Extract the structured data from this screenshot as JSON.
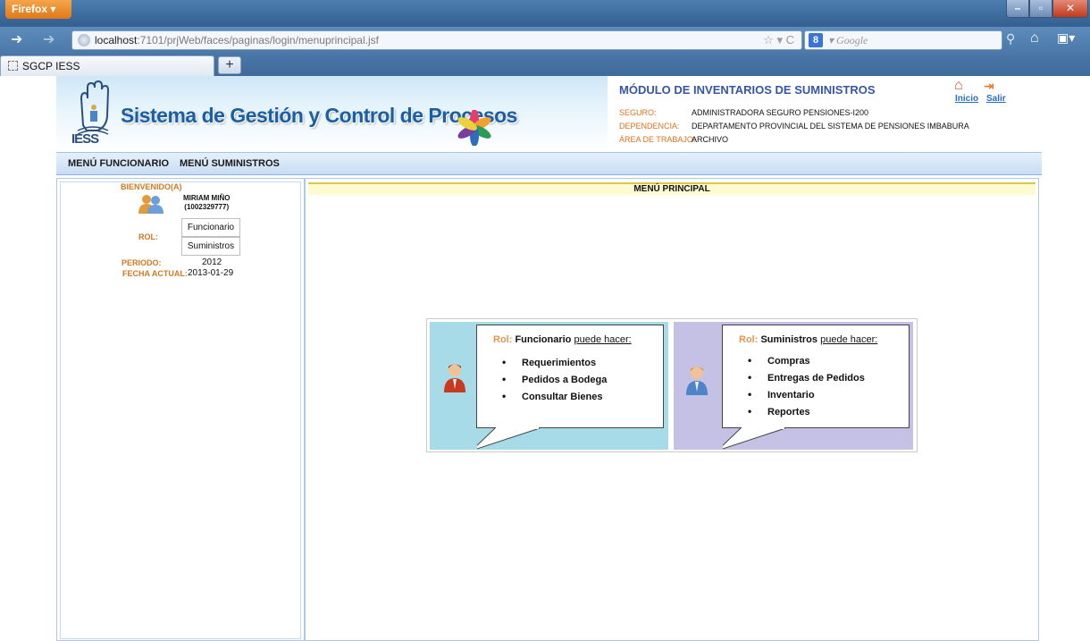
{
  "browser": {
    "firefox_label": "Firefox",
    "url_host": "localhost",
    "url_rest": ":7101/prjWeb/faces/paginas/login/menuprincipal.jsf",
    "search_placeholder": "Google",
    "tab_title": "SGCP IESS",
    "new_tab_label": "+"
  },
  "header": {
    "logo_text": "IESS",
    "app_title": "Sistema de Gestión y Control de Procesos",
    "module_title": "MÓDULO DE INVENTARIOS DE SUMINISTROS",
    "info": [
      {
        "key": "SEGURO:",
        "value": "ADMINISTRADORA SEGURO PENSIONES-I200"
      },
      {
        "key": "DEPENDENCIA:",
        "value": "DEPARTAMENTO PROVINCIAL DEL SISTEMA DE PENSIONES IMBABURA"
      },
      {
        "key": "ÁREA DE TRABAJO:",
        "value": "ARCHIVO"
      }
    ],
    "links": {
      "home": "Inicio",
      "logout": "Salir"
    }
  },
  "menubar": {
    "items": [
      "MENÚ FUNCIONARIO",
      "MENÚ SUMINISTROS"
    ]
  },
  "sidebar": {
    "welcome": "BIENVENIDO(A)",
    "user_name": "MIRIAM MIÑO",
    "user_id": "(1002329777)",
    "rol_label": "ROL:",
    "roles": [
      "Funcionario",
      "Suministros"
    ],
    "periodo_label": "PERIODO:",
    "periodo_value": "2012",
    "fecha_label": "FECHA ACTUAL:",
    "fecha_value": "2013-01-29"
  },
  "main": {
    "header": "MENÚ PRINCIPAL",
    "panels": [
      {
        "rol_word": "Rol:",
        "role": "Funcionario",
        "can_do": "puede hacer:",
        "items": [
          "Requerimientos",
          "Pedidos a Bodega",
          "Consultar Bienes"
        ],
        "color": "#a7dbe8"
      },
      {
        "rol_word": "Rol:",
        "role": "Suministros",
        "can_do": "puede hacer:",
        "items": [
          "Compras",
          "Entregas de Pedidos",
          "Inventario",
          "Reportes"
        ],
        "color": "#c4c1e5"
      }
    ]
  }
}
